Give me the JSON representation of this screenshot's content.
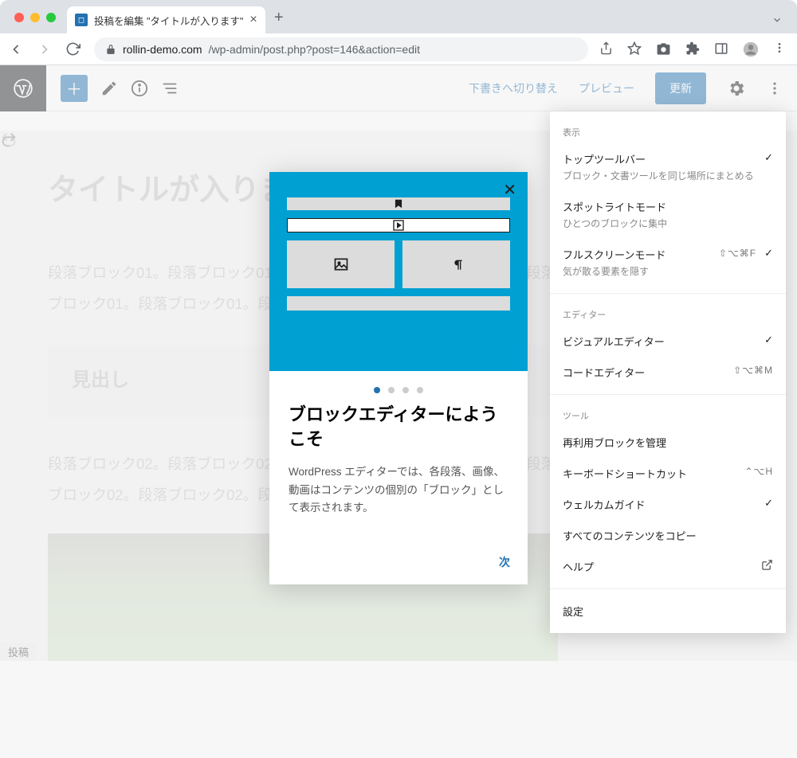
{
  "browser": {
    "tab_title": "投稿を編集 \"タイトルが入ります\"",
    "url_host": "rollin-demo.com",
    "url_path": "/wp-admin/post.php?post=146&action=edit"
  },
  "wp_toolbar": {
    "draft_switch": "下書きへ切り替え",
    "preview": "プレビュー",
    "update": "更新"
  },
  "content": {
    "title": "タイトルが入ります",
    "para1": "段落ブロック01。段落ブロック01。段落ブロック01。段落ブロック01。段落ブロック01。段落ブロック01。段落ブロック01。段落ブロック01。",
    "heading": "見出し",
    "para2": "段落ブロック02。段落ブロック02。段落ブロック02。段落ブロック02。段落ブロック02。段落ブロック02。段落ブロック02。段落ブロック02。"
  },
  "modal": {
    "title": "ブロックエディターにようこそ",
    "text": "WordPress エディターでは、各段落、画像、動画はコンテンツの個別の「ブロック」として表示されます。",
    "next": "次"
  },
  "dropdown": {
    "sections": {
      "display": "表示",
      "editor": "エディター",
      "tools": "ツール"
    },
    "top_toolbar": {
      "label": "トップツールバー",
      "sub": "ブロック・文書ツールを同じ場所にまとめる"
    },
    "spotlight": {
      "label": "スポットライトモード",
      "sub": "ひとつのブロックに集中"
    },
    "fullscreen": {
      "label": "フルスクリーンモード",
      "sub": "気が散る要素を隠す",
      "shortcut": "⇧⌥⌘F"
    },
    "visual": "ビジュアルエディター",
    "code": {
      "label": "コードエディター",
      "shortcut": "⇧⌥⌘M"
    },
    "reusable": "再利用ブロックを管理",
    "shortcuts": {
      "label": "キーボードショートカット",
      "shortcut": "⌃⌥H"
    },
    "welcome": "ウェルカムガイド",
    "copy_all": "すべてのコンテンツをコピー",
    "help": "ヘルプ",
    "settings": "設定"
  },
  "status": "投稿"
}
